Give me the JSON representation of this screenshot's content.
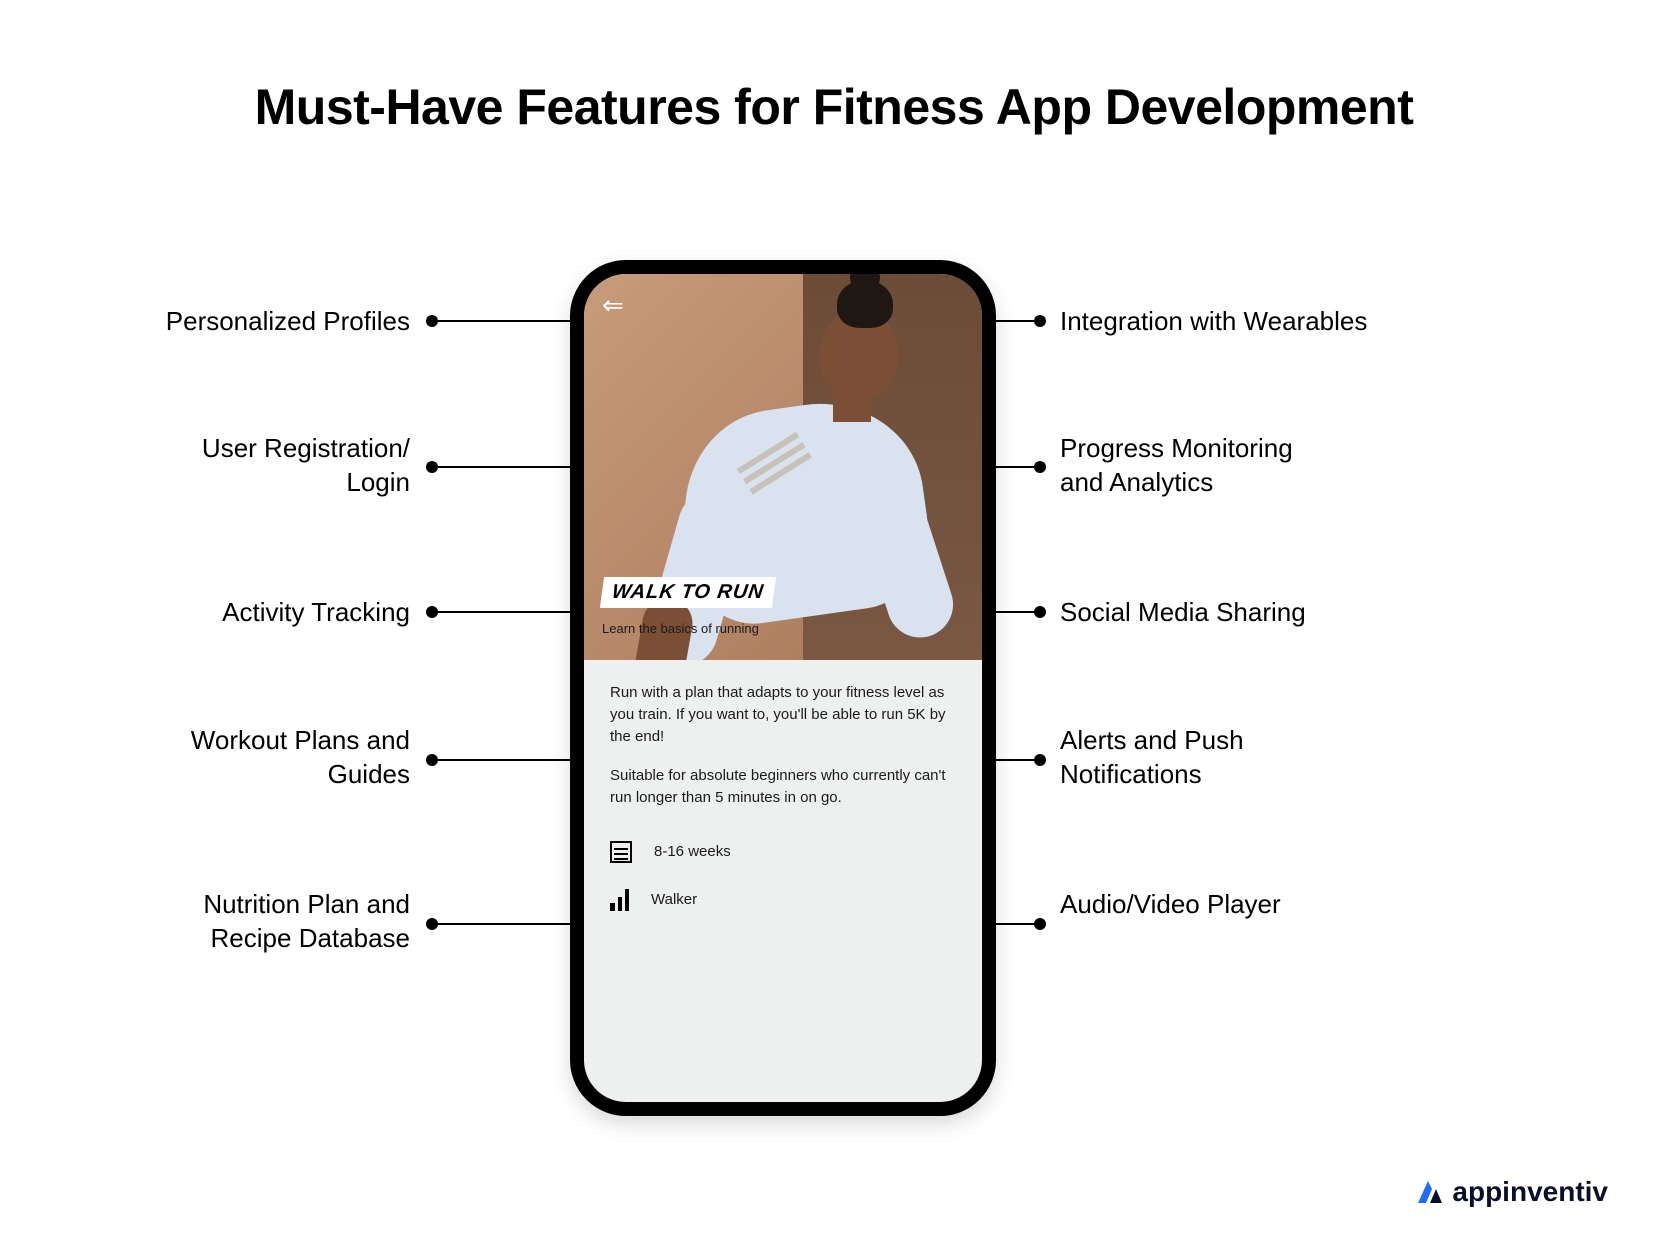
{
  "title": "Must-Have Features for Fitness App Development",
  "features_left": [
    "Personalized Profiles",
    "User Registration/\nLogin",
    "Activity Tracking",
    "Workout Plans and\nGuides",
    "Nutrition Plan and\nRecipe Database"
  ],
  "features_right": [
    "Integration with Wearables",
    "Progress Monitoring\nand Analytics",
    "Social Media Sharing",
    "Alerts and Push\nNotifications",
    "Audio/Video Player"
  ],
  "phone": {
    "program_title": "WALK TO RUN",
    "program_subtitle": "Learn the basics of running",
    "paragraph1": "Run with a plan that adapts to your fitness level as you train. If you want to, you'll be able to run 5K by the end!",
    "paragraph2": "Suitable for absolute beginners who currently can't run longer than 5 minutes in on go.",
    "duration": "8-16 weeks",
    "level": "Walker"
  },
  "brand": "appinventiv"
}
